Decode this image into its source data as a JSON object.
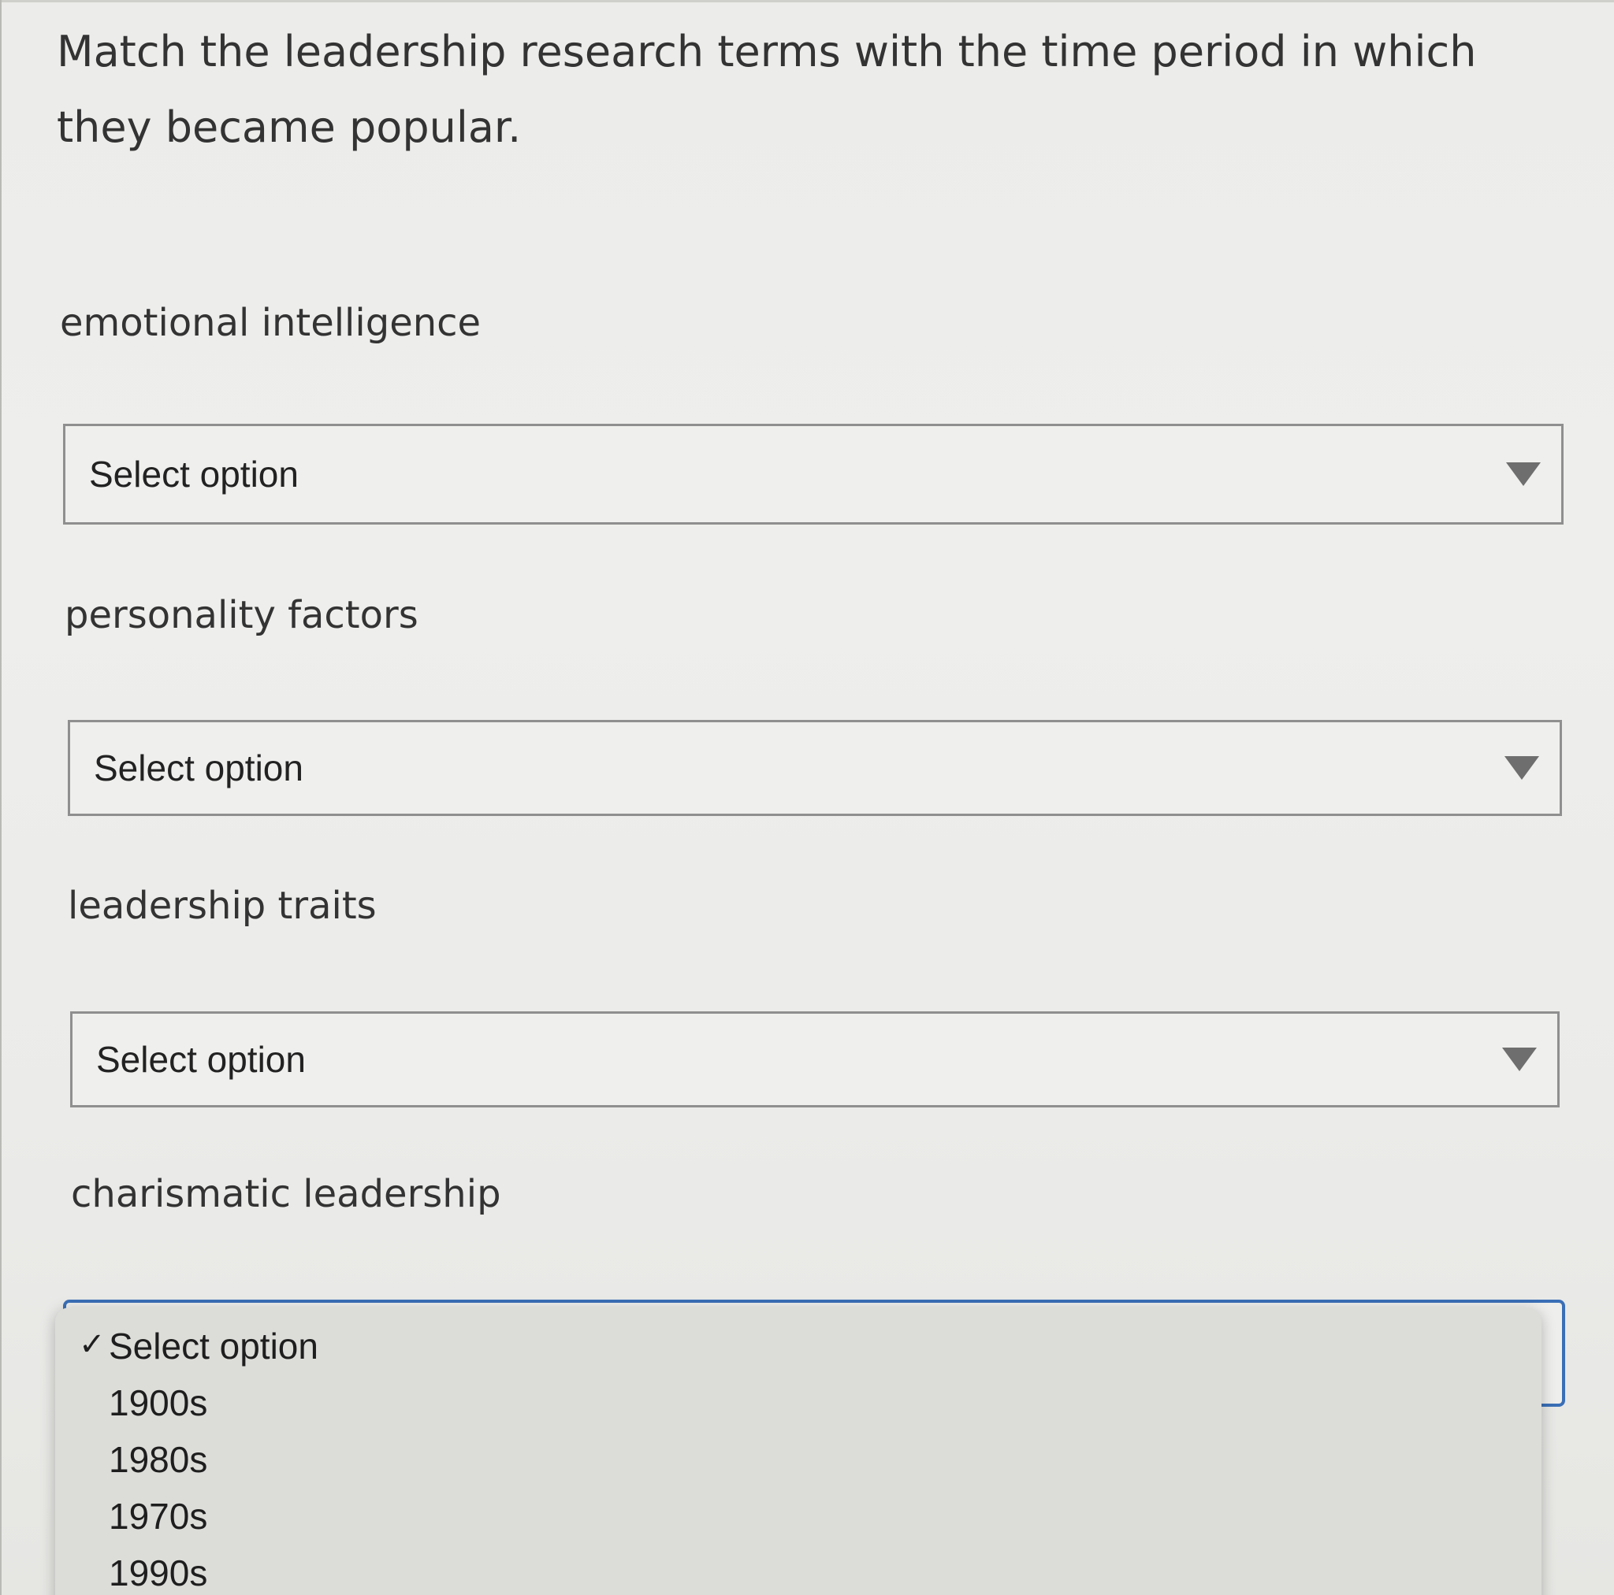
{
  "question": {
    "text": "Match the leadership research terms with the time period in which they became popular."
  },
  "items": [
    {
      "term": "emotional intelligence",
      "select_value": "Select option"
    },
    {
      "term": "personality factors",
      "select_value": "Select option"
    },
    {
      "term": "leadership traits",
      "select_value": "Select option"
    },
    {
      "term": "charismatic leadership",
      "select_value": "Select option"
    }
  ],
  "dropdown": {
    "options": [
      {
        "label": "Select option",
        "checked": true
      },
      {
        "label": "1900s",
        "checked": false
      },
      {
        "label": "1980s",
        "checked": false
      },
      {
        "label": "1970s",
        "checked": false
      },
      {
        "label": "1990s",
        "checked": false
      }
    ],
    "check_glyph": "✓"
  },
  "colors": {
    "focus_border": "#3a6fb6",
    "background": "#ececea"
  }
}
